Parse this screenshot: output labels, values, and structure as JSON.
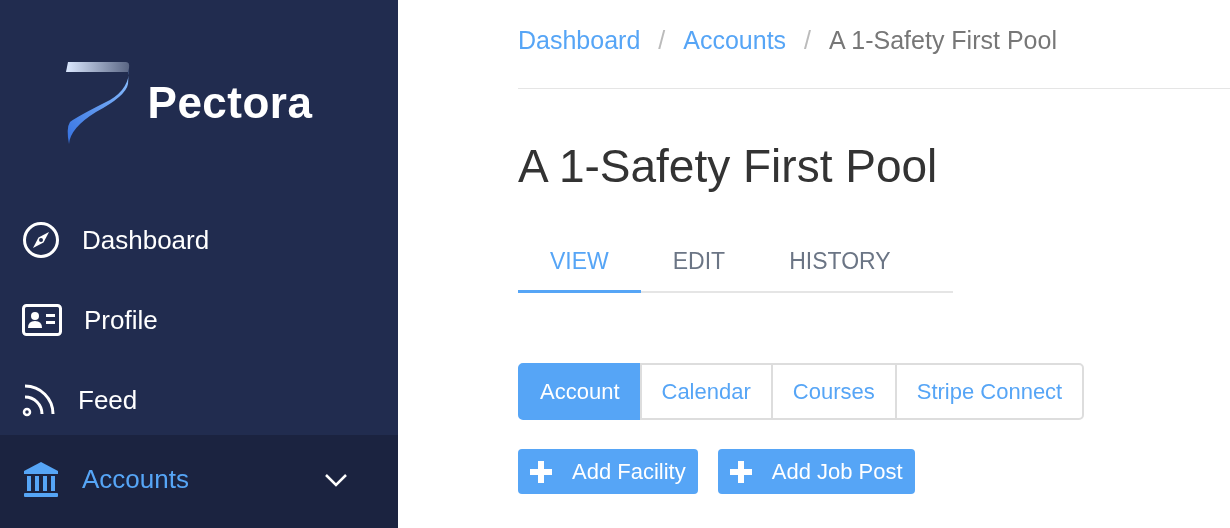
{
  "sidebar": {
    "logo": "Pectora",
    "items": [
      {
        "label": "Dashboard",
        "selected": false,
        "has_submenu": false
      },
      {
        "label": "Profile",
        "selected": false,
        "has_submenu": false
      },
      {
        "label": "Feed",
        "selected": false,
        "has_submenu": false
      },
      {
        "label": "Accounts",
        "selected": true,
        "has_submenu": true
      }
    ]
  },
  "breadcrumb": [
    {
      "label": "Dashboard",
      "link": true
    },
    {
      "separator": "/",
      "label": "Accounts",
      "link": true
    },
    {
      "separator": "/",
      "label": "A 1-Safety First Pool",
      "link": false
    }
  ],
  "title": "A 1-Safety First Pool",
  "tabs": [
    {
      "label": "VIEW",
      "selected": true
    },
    {
      "label": "EDIT",
      "selected": false
    },
    {
      "label": "HISTORY",
      "selected": false
    }
  ],
  "segments": [
    {
      "label": "Account",
      "selected": true
    },
    {
      "label": "Calendar",
      "selected": false
    },
    {
      "label": "Courses",
      "selected": false
    },
    {
      "label": "Stripe Connect",
      "selected": false
    }
  ],
  "actions": [
    {
      "label": "Add Facility"
    },
    {
      "label": "Add Job Post"
    }
  ]
}
